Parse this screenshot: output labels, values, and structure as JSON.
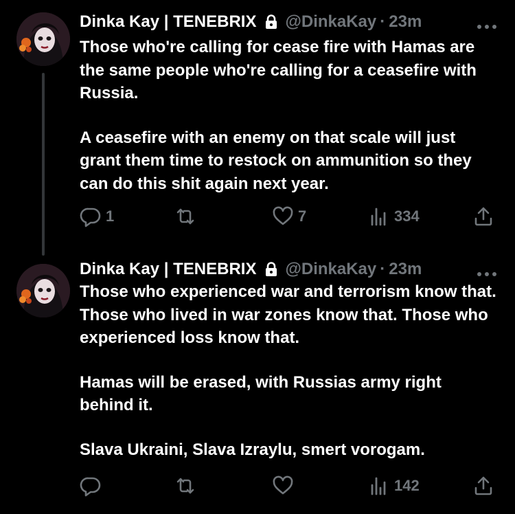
{
  "colors": {
    "background": "#000000",
    "text": "#ffffff",
    "secondary": "#71767b",
    "thread_line": "#333639"
  },
  "icons": {
    "verified_lock": "lock-icon",
    "more": "more-icon",
    "reply": "reply-icon",
    "repost": "repost-icon",
    "like": "heart-icon",
    "views": "views-icon",
    "share": "share-icon"
  },
  "tweets": [
    {
      "author_name": "Dinka Kay | TENEBRIX",
      "handle": "@DinkaKay",
      "separator": "·",
      "time": "23m",
      "paragraphs": [
        "Those who're calling for cease fire with Hamas are the same people who're calling for a ceasefire with Russia.",
        "A ceasefire with an enemy on that scale will just grant them time to restock on ammunition so they can do this shit again next year."
      ],
      "replies": "1",
      "reposts": "",
      "likes": "7",
      "views": "334"
    },
    {
      "author_name": "Dinka Kay | TENEBRIX",
      "handle": "@DinkaKay",
      "separator": "·",
      "time": "23m",
      "paragraphs": [
        "Those who experienced war and terrorism know that. Those who lived in war zones know that. Those who experienced loss know that.",
        "Hamas will be erased, with Russias army right behind it.",
        "Slava Ukraini, Slava Izraylu, smert vorogam."
      ],
      "replies": "",
      "reposts": "",
      "likes": "",
      "views": "142"
    }
  ]
}
